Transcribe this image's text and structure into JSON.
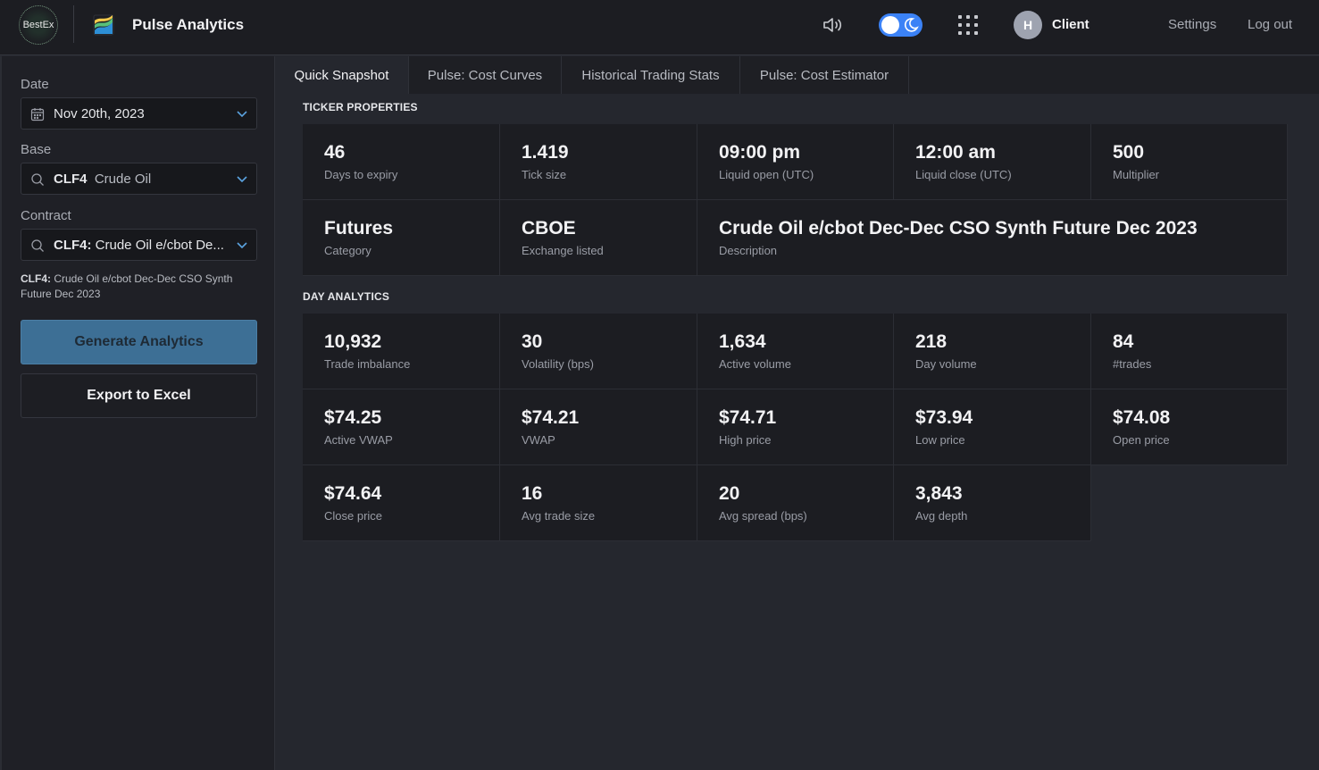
{
  "header": {
    "logo_text": "BestEx",
    "app_title": "Pulse Analytics",
    "user_initial": "H",
    "user_name": "Client",
    "settings_label": "Settings",
    "logout_label": "Log out",
    "accent_color": "#3b82f6"
  },
  "sidebar": {
    "date_label": "Date",
    "date_value": "Nov 20th, 2023",
    "base_label": "Base",
    "base_code": "CLF4",
    "base_name": "Crude Oil",
    "contract_label": "Contract",
    "contract_code": "CLF4:",
    "contract_name": "Crude Oil e/cbot De...",
    "contract_desc_code": "CLF4:",
    "contract_desc_text": "Crude Oil e/cbot Dec-Dec CSO Synth Future Dec 2023",
    "generate_label": "Generate Analytics",
    "export_label": "Export to Excel"
  },
  "tabs": [
    {
      "label": "Quick Snapshot"
    },
    {
      "label": "Pulse: Cost Curves"
    },
    {
      "label": "Historical Trading Stats"
    },
    {
      "label": "Pulse: Cost Estimator"
    }
  ],
  "ticker": {
    "title": "TICKER PROPERTIES",
    "cards": [
      {
        "value": "46",
        "label": "Days to expiry"
      },
      {
        "value": "1.419",
        "label": "Tick size"
      },
      {
        "value": "09:00 pm",
        "label": "Liquid open (UTC)"
      },
      {
        "value": "12:00 am",
        "label": "Liquid close (UTC)"
      },
      {
        "value": "500",
        "label": "Multiplier"
      },
      {
        "value": "Futures",
        "label": "Category"
      },
      {
        "value": "CBOE",
        "label": "Exchange listed"
      },
      {
        "value": "Crude Oil e/cbot Dec-Dec CSO Synth Future Dec 2023",
        "label": "Description"
      }
    ]
  },
  "day": {
    "title": "DAY ANALYTICS",
    "cards": [
      {
        "value": "10,932",
        "label": "Trade imbalance"
      },
      {
        "value": "30",
        "label": "Volatility (bps)"
      },
      {
        "value": "1,634",
        "label": "Active volume"
      },
      {
        "value": "218",
        "label": "Day volume"
      },
      {
        "value": "84",
        "label": "#trades"
      },
      {
        "value": "$74.25",
        "label": "Active VWAP"
      },
      {
        "value": "$74.21",
        "label": "VWAP"
      },
      {
        "value": "$74.71",
        "label": "High price"
      },
      {
        "value": "$73.94",
        "label": "Low price"
      },
      {
        "value": "$74.08",
        "label": "Open price"
      },
      {
        "value": "$74.64",
        "label": "Close price"
      },
      {
        "value": "16",
        "label": "Avg trade size"
      },
      {
        "value": "20",
        "label": "Avg spread (bps)"
      },
      {
        "value": "3,843",
        "label": "Avg depth"
      }
    ]
  }
}
